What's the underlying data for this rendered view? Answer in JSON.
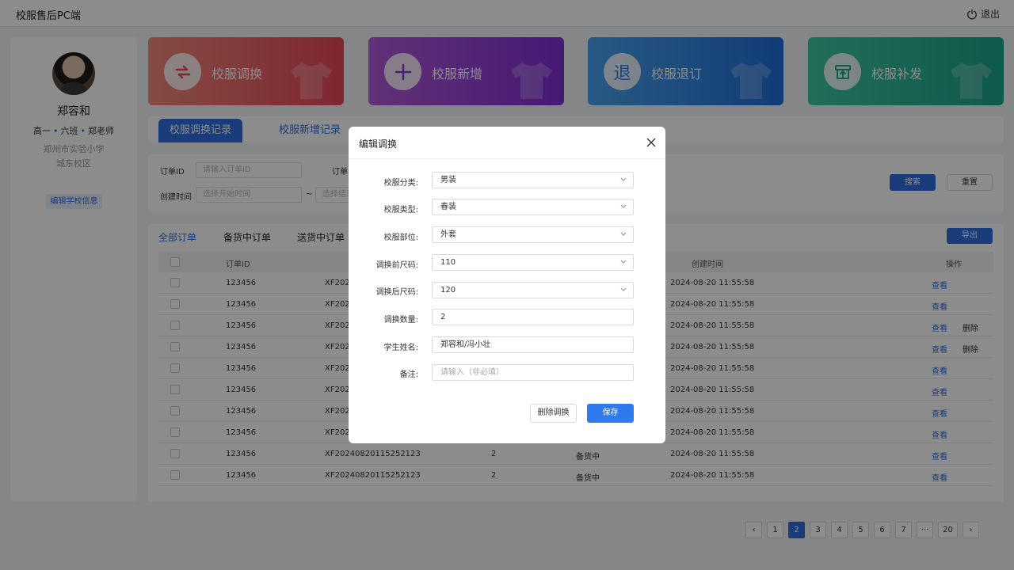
{
  "header": {
    "app_title": "校服售后PC端",
    "logout_label": "退出"
  },
  "profile": {
    "name": "郑容和",
    "grade": "高一",
    "class": "六班",
    "teacher": "郑老师",
    "school": "郑州市实验小学",
    "campus": "城东校区",
    "edit_button": "编辑学校信息"
  },
  "cards": [
    {
      "label": "校服调换",
      "icon": "swap-icon",
      "color": "#e9475a"
    },
    {
      "label": "校服新增",
      "icon": "plus-icon",
      "color": "#8a3bd8"
    },
    {
      "label": "校服退订",
      "icon": "refund-icon",
      "glyph": "退",
      "color": "#2b7fe0"
    },
    {
      "label": "校服补发",
      "icon": "box-upload-icon",
      "color": "#20a88c"
    }
  ],
  "record_tabs": [
    {
      "label": "校服调换记录",
      "active": true
    },
    {
      "label": "校服新增记录",
      "active": false
    }
  ],
  "filters": {
    "order_id_label": "订单ID",
    "order_id_placeholder": "请输入订单ID",
    "order_no_label": "订单",
    "created_label": "创建时间",
    "start_placeholder": "选择开始时间",
    "range_sep": "~",
    "end_placeholder": "选择结束",
    "search_button": "搜索",
    "reset_button": "重置"
  },
  "table": {
    "status_tabs": [
      {
        "label": "全部订单",
        "active": true
      },
      {
        "label": "备货中订单",
        "active": false
      },
      {
        "label": "送货中订单",
        "active": false
      }
    ],
    "export_button": "导出",
    "columns": {
      "order_id": "订单ID",
      "created": "创建时间",
      "actions": "操作"
    },
    "rows": [
      {
        "id": "123456",
        "order_no": "XF2024",
        "qty": "",
        "status": "",
        "created": "2024-08-20  11:55:58",
        "view": "查看",
        "delete": ""
      },
      {
        "id": "123456",
        "order_no": "XF2024",
        "qty": "",
        "status": "",
        "created": "2024-08-20  11:55:58",
        "view": "查看",
        "delete": ""
      },
      {
        "id": "123456",
        "order_no": "XF2024",
        "qty": "",
        "status": "",
        "created": "2024-08-20  11:55:58",
        "view": "查看",
        "delete": "删除"
      },
      {
        "id": "123456",
        "order_no": "XF2024",
        "qty": "",
        "status": "",
        "created": "2024-08-20  11:55:58",
        "view": "查看",
        "delete": "删除"
      },
      {
        "id": "123456",
        "order_no": "XF2024",
        "qty": "",
        "status": "",
        "created": "2024-08-20  11:55:58",
        "view": "查看",
        "delete": ""
      },
      {
        "id": "123456",
        "order_no": "XF2024",
        "qty": "",
        "status": "",
        "created": "2024-08-20  11:55:58",
        "view": "查看",
        "delete": ""
      },
      {
        "id": "123456",
        "order_no": "XF2024",
        "qty": "",
        "status": "",
        "created": "2024-08-20  11:55:58",
        "view": "查看",
        "delete": ""
      },
      {
        "id": "123456",
        "order_no": "XF2024",
        "qty": "",
        "status": "",
        "created": "2024-08-20  11:55:58",
        "view": "查看",
        "delete": ""
      },
      {
        "id": "123456",
        "order_no": "XF20240820115252123",
        "qty": "2",
        "status": "备货中",
        "created": "2024-08-20  11:55:58",
        "view": "查看",
        "delete": ""
      },
      {
        "id": "123456",
        "order_no": "XF20240820115252123",
        "qty": "2",
        "status": "备货中",
        "created": "2024-08-20  11:55:58",
        "view": "查看",
        "delete": ""
      }
    ]
  },
  "pagination": {
    "prev": "‹",
    "pages": [
      "1",
      "2",
      "3",
      "4",
      "5",
      "6",
      "7",
      "···",
      "20"
    ],
    "current": "2",
    "next": "›"
  },
  "modal": {
    "title": "编辑调换",
    "fields": [
      {
        "label": "校服分类:",
        "value": "男装",
        "type": "select"
      },
      {
        "label": "校服类型:",
        "value": "春装",
        "type": "select"
      },
      {
        "label": "校服部位:",
        "value": "外套",
        "type": "select"
      },
      {
        "label": "调换前尺码:",
        "value": "110",
        "type": "select"
      },
      {
        "label": "调换后尺码:",
        "value": "120",
        "type": "select"
      },
      {
        "label": "调换数量:",
        "value": "2",
        "type": "input"
      },
      {
        "label": "学生姓名:",
        "value": "郑容和/冯小壮",
        "type": "input"
      },
      {
        "label": "备注:",
        "value": "",
        "placeholder": "请输入（非必填）",
        "type": "input"
      }
    ],
    "delete_button": "删除调换",
    "save_button": "保存"
  }
}
